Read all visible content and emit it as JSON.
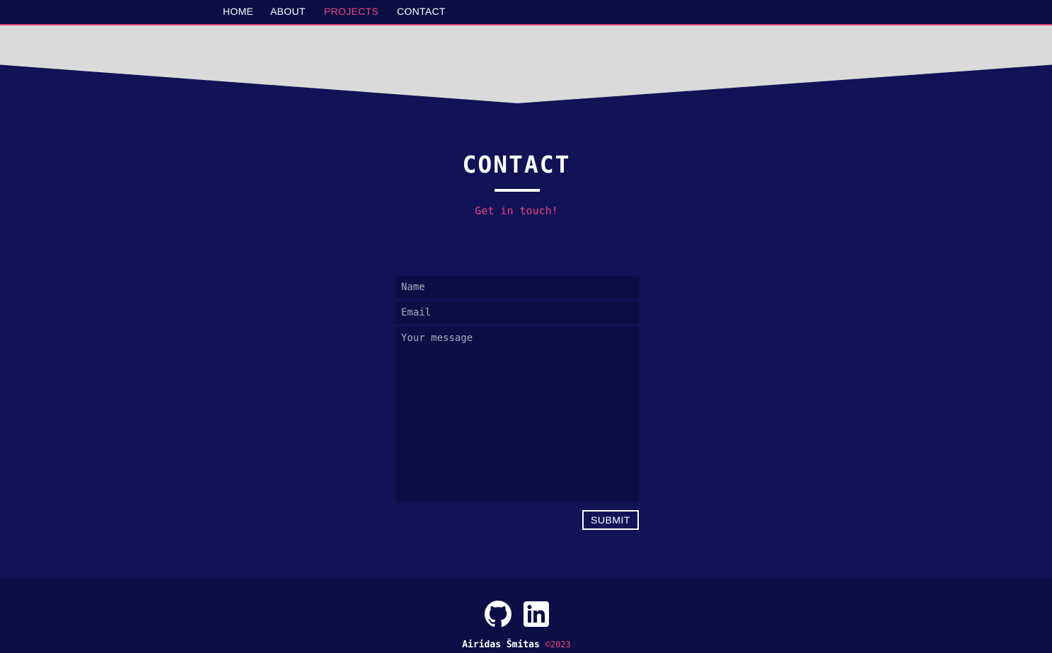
{
  "nav": {
    "items": [
      {
        "label": "HOME",
        "active": false
      },
      {
        "label": "ABOUT",
        "active": false
      },
      {
        "label": "PROJECTS",
        "active": true
      },
      {
        "label": "CONTACT",
        "active": false
      }
    ]
  },
  "contact": {
    "title": "CONTACT",
    "subtitle": "Get in touch!",
    "form": {
      "name_placeholder": "Name",
      "email_placeholder": "Email",
      "message_placeholder": "Your message",
      "submit_label": "SUBMIT"
    }
  },
  "footer": {
    "social": [
      {
        "icon": "github-icon"
      },
      {
        "icon": "linkedin-icon"
      }
    ],
    "author": "Airidas Šmitas",
    "copyright": "©2023"
  },
  "colors": {
    "accent": "#e94582",
    "background": "#111356",
    "nav_background": "#0c0e45",
    "banner": "#dadada"
  }
}
